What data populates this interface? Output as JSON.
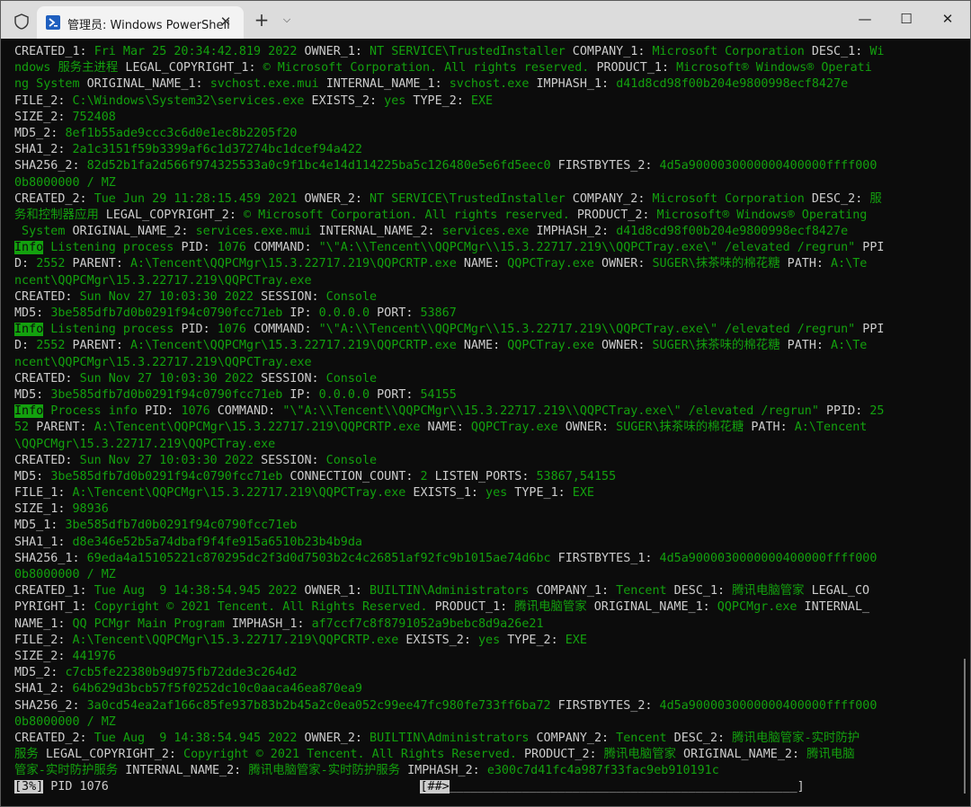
{
  "window": {
    "tab_title": "管理员: Windows PowerShell",
    "tab_close": "✕",
    "new_tab": "+",
    "dropdown": "⌵",
    "minimize": "—",
    "maximize": "☐",
    "close": "✕"
  },
  "colors": {
    "white": "#cccccc",
    "green": "#13a10e",
    "background": "#0c0c0c"
  },
  "lines": [
    [
      [
        "w",
        "CREATED_1: "
      ],
      [
        "g",
        "Fri Mar 25 20:34:42.819 2022 "
      ],
      [
        "w",
        "OWNER_1: "
      ],
      [
        "g",
        "NT SERVICE\\TrustedInstaller "
      ],
      [
        "w",
        "COMPANY_1: "
      ],
      [
        "g",
        "Microsoft Corporation "
      ],
      [
        "w",
        "DESC_1: "
      ],
      [
        "g",
        "Wi"
      ]
    ],
    [
      [
        "g",
        "ndows 服务主进程 "
      ],
      [
        "w",
        "LEGAL_COPYRIGHT_1: "
      ],
      [
        "g",
        "© Microsoft Corporation. All rights reserved. "
      ],
      [
        "w",
        "PRODUCT_1: "
      ],
      [
        "g",
        "Microsoft® Windows® Operati"
      ]
    ],
    [
      [
        "g",
        "ng System "
      ],
      [
        "w",
        "ORIGINAL_NAME_1: "
      ],
      [
        "g",
        "svchost.exe.mui "
      ],
      [
        "w",
        "INTERNAL_NAME_1: "
      ],
      [
        "g",
        "svchost.exe "
      ],
      [
        "w",
        "IMPHASH_1: "
      ],
      [
        "g",
        "d41d8cd98f00b204e9800998ecf8427e"
      ]
    ],
    [
      [
        "w",
        "FILE_2: "
      ],
      [
        "g",
        "C:\\Windows\\System32\\services.exe "
      ],
      [
        "w",
        "EXISTS_2: "
      ],
      [
        "g",
        "yes "
      ],
      [
        "w",
        "TYPE_2: "
      ],
      [
        "g",
        "EXE"
      ]
    ],
    [
      [
        "w",
        "SIZE_2: "
      ],
      [
        "g",
        "752408"
      ]
    ],
    [
      [
        "w",
        "MD5_2: "
      ],
      [
        "g",
        "8ef1b55ade9ccc3c6d0e1ec8b2205f20"
      ]
    ],
    [
      [
        "w",
        "SHA1_2: "
      ],
      [
        "g",
        "2a1c3151f59b3399af6c1d37274bc1dcef94a422"
      ]
    ],
    [
      [
        "w",
        "SHA256_2: "
      ],
      [
        "g",
        "82d52b1fa2d566f974325533a0c9f1bc4e14d114225ba5c126480e5e6fd5eec0 "
      ],
      [
        "w",
        "FIRSTBYTES_2: "
      ],
      [
        "g",
        "4d5a9000030000000400000ffff000"
      ]
    ],
    [
      [
        "g",
        "0b8000000 / MZ"
      ]
    ],
    [
      [
        "w",
        "CREATED_2: "
      ],
      [
        "g",
        "Tue Jun 29 11:28:15.459 2021 "
      ],
      [
        "w",
        "OWNER_2: "
      ],
      [
        "g",
        "NT SERVICE\\TrustedInstaller "
      ],
      [
        "w",
        "COMPANY_2: "
      ],
      [
        "g",
        "Microsoft Corporation "
      ],
      [
        "w",
        "DESC_2: "
      ],
      [
        "g",
        "服"
      ]
    ],
    [
      [
        "g",
        "务和控制器应用 "
      ],
      [
        "w",
        "LEGAL_COPYRIGHT_2: "
      ],
      [
        "g",
        "© Microsoft Corporation. All rights reserved. "
      ],
      [
        "w",
        "PRODUCT_2: "
      ],
      [
        "g",
        "Microsoft® Windows® Operating"
      ]
    ],
    [
      [
        "g",
        " System "
      ],
      [
        "w",
        "ORIGINAL_NAME_2: "
      ],
      [
        "g",
        "services.exe.mui "
      ],
      [
        "w",
        "INTERNAL_NAME_2: "
      ],
      [
        "g",
        "services.exe "
      ],
      [
        "w",
        "IMPHASH_2: "
      ],
      [
        "g",
        "d41d8cd98f00b204e9800998ecf8427e"
      ]
    ],
    [
      [
        "i",
        "Info"
      ],
      [
        "g",
        " Listening process "
      ],
      [
        "w",
        "PID: "
      ],
      [
        "g",
        "1076 "
      ],
      [
        "w",
        "COMMAND: "
      ],
      [
        "g",
        "\"\\\"A:\\\\Tencent\\\\QQPCMgr\\\\15.3.22717.219\\\\QQPCTray.exe\\\" /elevated /regrun\" "
      ],
      [
        "w",
        "PPI"
      ]
    ],
    [
      [
        "w",
        "D: "
      ],
      [
        "g",
        "2552 "
      ],
      [
        "w",
        "PARENT: "
      ],
      [
        "g",
        "A:\\Tencent\\QQPCMgr\\15.3.22717.219\\QQPCRTP.exe "
      ],
      [
        "w",
        "NAME: "
      ],
      [
        "g",
        "QQPCTray.exe "
      ],
      [
        "w",
        "OWNER: "
      ],
      [
        "g",
        "SUGER\\抹茶味的棉花糖 "
      ],
      [
        "w",
        "PATH: "
      ],
      [
        "g",
        "A:\\Te"
      ]
    ],
    [
      [
        "g",
        "ncent\\QQPCMgr\\15.3.22717.219\\QQPCTray.exe"
      ]
    ],
    [
      [
        "w",
        "CREATED: "
      ],
      [
        "g",
        "Sun Nov 27 10:03:30 2022 "
      ],
      [
        "w",
        "SESSION: "
      ],
      [
        "g",
        "Console"
      ]
    ],
    [
      [
        "w",
        "MD5: "
      ],
      [
        "g",
        "3be585dfb7d0b0291f94c0790fcc71eb "
      ],
      [
        "w",
        "IP: "
      ],
      [
        "g",
        "0.0.0.0 "
      ],
      [
        "w",
        "PORT: "
      ],
      [
        "g",
        "53867"
      ]
    ],
    [
      [
        "i",
        "Info"
      ],
      [
        "g",
        " Listening process "
      ],
      [
        "w",
        "PID: "
      ],
      [
        "g",
        "1076 "
      ],
      [
        "w",
        "COMMAND: "
      ],
      [
        "g",
        "\"\\\"A:\\\\Tencent\\\\QQPCMgr\\\\15.3.22717.219\\\\QQPCTray.exe\\\" /elevated /regrun\" "
      ],
      [
        "w",
        "PPI"
      ]
    ],
    [
      [
        "w",
        "D: "
      ],
      [
        "g",
        "2552 "
      ],
      [
        "w",
        "PARENT: "
      ],
      [
        "g",
        "A:\\Tencent\\QQPCMgr\\15.3.22717.219\\QQPCRTP.exe "
      ],
      [
        "w",
        "NAME: "
      ],
      [
        "g",
        "QQPCTray.exe "
      ],
      [
        "w",
        "OWNER: "
      ],
      [
        "g",
        "SUGER\\抹茶味的棉花糖 "
      ],
      [
        "w",
        "PATH: "
      ],
      [
        "g",
        "A:\\Te"
      ]
    ],
    [
      [
        "g",
        "ncent\\QQPCMgr\\15.3.22717.219\\QQPCTray.exe"
      ]
    ],
    [
      [
        "w",
        "CREATED: "
      ],
      [
        "g",
        "Sun Nov 27 10:03:30 2022 "
      ],
      [
        "w",
        "SESSION: "
      ],
      [
        "g",
        "Console"
      ]
    ],
    [
      [
        "w",
        "MD5: "
      ],
      [
        "g",
        "3be585dfb7d0b0291f94c0790fcc71eb "
      ],
      [
        "w",
        "IP: "
      ],
      [
        "g",
        "0.0.0.0 "
      ],
      [
        "w",
        "PORT: "
      ],
      [
        "g",
        "54155"
      ]
    ],
    [
      [
        "i",
        "Info"
      ],
      [
        "g",
        " Process info "
      ],
      [
        "w",
        "PID: "
      ],
      [
        "g",
        "1076 "
      ],
      [
        "w",
        "COMMAND: "
      ],
      [
        "g",
        "\"\\\"A:\\\\Tencent\\\\QQPCMgr\\\\15.3.22717.219\\\\QQPCTray.exe\\\" /elevated /regrun\" "
      ],
      [
        "w",
        "PPID: "
      ],
      [
        "g",
        "25"
      ]
    ],
    [
      [
        "g",
        "52 "
      ],
      [
        "w",
        "PARENT: "
      ],
      [
        "g",
        "A:\\Tencent\\QQPCMgr\\15.3.22717.219\\QQPCRTP.exe "
      ],
      [
        "w",
        "NAME: "
      ],
      [
        "g",
        "QQPCTray.exe "
      ],
      [
        "w",
        "OWNER: "
      ],
      [
        "g",
        "SUGER\\抹茶味的棉花糖 "
      ],
      [
        "w",
        "PATH: "
      ],
      [
        "g",
        "A:\\Tencent"
      ]
    ],
    [
      [
        "g",
        "\\QQPCMgr\\15.3.22717.219\\QQPCTray.exe"
      ]
    ],
    [
      [
        "w",
        "CREATED: "
      ],
      [
        "g",
        "Sun Nov 27 10:03:30 2022 "
      ],
      [
        "w",
        "SESSION: "
      ],
      [
        "g",
        "Console"
      ]
    ],
    [
      [
        "w",
        "MD5: "
      ],
      [
        "g",
        "3be585dfb7d0b0291f94c0790fcc71eb "
      ],
      [
        "w",
        "CONNECTION_COUNT: "
      ],
      [
        "g",
        "2 "
      ],
      [
        "w",
        "LISTEN_PORTS: "
      ],
      [
        "g",
        "53867,54155"
      ]
    ],
    [
      [
        "w",
        "FILE_1: "
      ],
      [
        "g",
        "A:\\Tencent\\QQPCMgr\\15.3.22717.219\\QQPCTray.exe "
      ],
      [
        "w",
        "EXISTS_1: "
      ],
      [
        "g",
        "yes "
      ],
      [
        "w",
        "TYPE_1: "
      ],
      [
        "g",
        "EXE"
      ]
    ],
    [
      [
        "w",
        "SIZE_1: "
      ],
      [
        "g",
        "98936"
      ]
    ],
    [
      [
        "w",
        "MD5_1: "
      ],
      [
        "g",
        "3be585dfb7d0b0291f94c0790fcc71eb"
      ]
    ],
    [
      [
        "w",
        "SHA1_1: "
      ],
      [
        "g",
        "d8e346e52b5a74dbaf9f4fe915a6510b23b4b9da"
      ]
    ],
    [
      [
        "w",
        "SHA256_1: "
      ],
      [
        "g",
        "69eda4a15105221c870295dc2f3d0d7503b2c4c26851af92fc9b1015ae74d6bc "
      ],
      [
        "w",
        "FIRSTBYTES_1: "
      ],
      [
        "g",
        "4d5a9000030000000400000ffff000"
      ]
    ],
    [
      [
        "g",
        "0b8000000 / MZ"
      ]
    ],
    [
      [
        "w",
        "CREATED_1: "
      ],
      [
        "g",
        "Tue Aug  9 14:38:54.945 2022 "
      ],
      [
        "w",
        "OWNER_1: "
      ],
      [
        "g",
        "BUILTIN\\Administrators "
      ],
      [
        "w",
        "COMPANY_1: "
      ],
      [
        "g",
        "Tencent "
      ],
      [
        "w",
        "DESC_1: "
      ],
      [
        "g",
        "腾讯电脑管家 "
      ],
      [
        "w",
        "LEGAL_CO"
      ]
    ],
    [
      [
        "w",
        "PYRIGHT_1: "
      ],
      [
        "g",
        "Copyright © 2021 Tencent. All Rights Reserved. "
      ],
      [
        "w",
        "PRODUCT_1: "
      ],
      [
        "g",
        "腾讯电脑管家 "
      ],
      [
        "w",
        "ORIGINAL_NAME_1: "
      ],
      [
        "g",
        "QQPCMgr.exe "
      ],
      [
        "w",
        "INTERNAL_"
      ]
    ],
    [
      [
        "w",
        "NAME_1: "
      ],
      [
        "g",
        "QQ PCMgr Main Program "
      ],
      [
        "w",
        "IMPHASH_1: "
      ],
      [
        "g",
        "af7ccf7c8f8791052a9bebc8d9a26e21"
      ]
    ],
    [
      [
        "w",
        "FILE_2: "
      ],
      [
        "g",
        "A:\\Tencent\\QQPCMgr\\15.3.22717.219\\QQPCRTP.exe "
      ],
      [
        "w",
        "EXISTS_2: "
      ],
      [
        "g",
        "yes "
      ],
      [
        "w",
        "TYPE_2: "
      ],
      [
        "g",
        "EXE"
      ]
    ],
    [
      [
        "w",
        "SIZE_2: "
      ],
      [
        "g",
        "441976"
      ]
    ],
    [
      [
        "w",
        "MD5_2: "
      ],
      [
        "g",
        "c7cb5fe22380b9d975fb72dde3c264d2"
      ]
    ],
    [
      [
        "w",
        "SHA1_2: "
      ],
      [
        "g",
        "64b629d3bcb57f5f0252dc10c0aaca46ea870ea9"
      ]
    ],
    [
      [
        "w",
        "SHA256_2: "
      ],
      [
        "g",
        "3a0cd54ea2af166c85fe937b83b2b45a2c0ea052c99ee47fc980fe733ff6ba72 "
      ],
      [
        "w",
        "FIRSTBYTES_2: "
      ],
      [
        "g",
        "4d5a9000030000000400000ffff000"
      ]
    ],
    [
      [
        "g",
        "0b8000000 / MZ"
      ]
    ],
    [
      [
        "w",
        "CREATED_2: "
      ],
      [
        "g",
        "Tue Aug  9 14:38:54.945 2022 "
      ],
      [
        "w",
        "OWNER_2: "
      ],
      [
        "g",
        "BUILTIN\\Administrators "
      ],
      [
        "w",
        "COMPANY_2: "
      ],
      [
        "g",
        "Tencent "
      ],
      [
        "w",
        "DESC_2: "
      ],
      [
        "g",
        "腾讯电脑管家-实时防护"
      ]
    ],
    [
      [
        "g",
        "服务 "
      ],
      [
        "w",
        "LEGAL_COPYRIGHT_2: "
      ],
      [
        "g",
        "Copyright © 2021 Tencent. All Rights Reserved. "
      ],
      [
        "w",
        "PRODUCT_2: "
      ],
      [
        "g",
        "腾讯电脑管家 "
      ],
      [
        "w",
        "ORIGINAL_NAME_2: "
      ],
      [
        "g",
        "腾讯电脑"
      ]
    ],
    [
      [
        "g",
        "管家-实时防护服务 "
      ],
      [
        "w",
        "INTERNAL_NAME_2: "
      ],
      [
        "g",
        "腾讯电脑管家-实时防护服务 "
      ],
      [
        "w",
        "IMPHASH_2: "
      ],
      [
        "g",
        "e300c7d41fc4a987f33fac9eb910191c"
      ]
    ],
    [
      [
        "b",
        "[3%]"
      ],
      [
        "w",
        " PID 1076                                           "
      ],
      [
        "b",
        "[##>"
      ],
      [
        "w",
        "________________________________________________]"
      ]
    ]
  ]
}
